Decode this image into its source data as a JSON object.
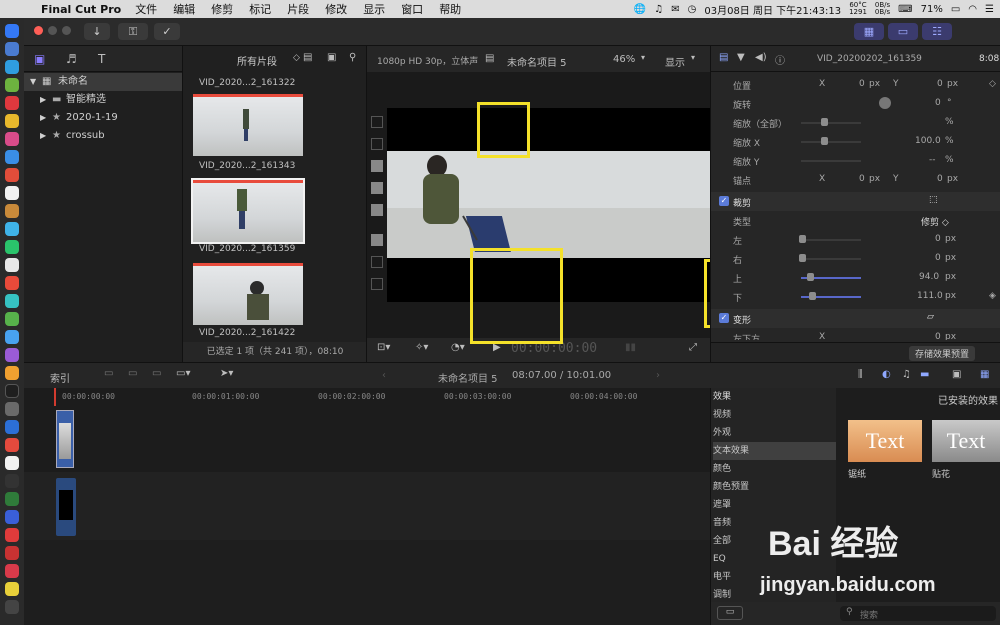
{
  "menubar": {
    "apple": "",
    "app_name": "Final Cut Pro",
    "menus": [
      "文件",
      "编辑",
      "修剪",
      "标记",
      "片段",
      "修改",
      "显示",
      "窗口",
      "帮助"
    ],
    "status": {
      "temp": "60°C",
      "fan": "1291",
      "net_up": "0B/s",
      "net_down": "0B/s",
      "battery": "71%",
      "datetime": "03月08日 周日 下午21:43:13"
    }
  },
  "toolbar": {
    "import_icon": "download-arrow-icon",
    "key_icon": "key-icon",
    "check_icon": "checkmark-circle-icon"
  },
  "library": {
    "filter_label": "所有片段",
    "items": [
      {
        "label": "未命名",
        "icon": "library-grid-icon",
        "selected": true
      },
      {
        "label": "智能精选",
        "icon": "folder-icon"
      },
      {
        "label": "2020-1-19",
        "icon": "event-star-icon"
      },
      {
        "label": "crossub",
        "icon": "event-star-icon"
      }
    ]
  },
  "browser": {
    "clips": [
      {
        "name": "VID_2020...2_161322"
      },
      {
        "name": "VID_2020...2_161343"
      },
      {
        "name": "VID_2020...2_161359"
      },
      {
        "name": "VID_2020...2_161422"
      }
    ],
    "status": "已选定 1 项（共 241 项），08:10"
  },
  "viewer": {
    "format": "1080p HD 30p，立体声",
    "project": "未命名项目 5",
    "zoom": "46%",
    "display_menu": "显示",
    "timecode": "00:00:00:00"
  },
  "inspector": {
    "clip_name": "VID_20200202_161359",
    "duration": "8:08",
    "rows": {
      "position": {
        "label": "位置",
        "x_label": "X",
        "x": "0",
        "x_unit": "px",
        "y_label": "Y",
        "y": "0",
        "y_unit": "px"
      },
      "rotation": {
        "label": "旋转",
        "value": "0",
        "unit": "°"
      },
      "scale_all": {
        "label": "缩放（全部）",
        "unit": "%"
      },
      "scale_x": {
        "label": "缩放 X",
        "value": "100.0",
        "unit": "%"
      },
      "scale_y": {
        "label": "缩放 Y",
        "value": "--",
        "unit": "%"
      },
      "anchor": {
        "label": "锚点",
        "x_label": "X",
        "x": "0",
        "x_unit": "px",
        "y_label": "Y",
        "y": "0",
        "y_unit": "px"
      },
      "crop_section": {
        "label": "裁剪"
      },
      "crop_type": {
        "label": "类型",
        "value": "修剪 ◇"
      },
      "crop_left": {
        "label": "左",
        "value": "0",
        "unit": "px"
      },
      "crop_right": {
        "label": "右",
        "value": "0",
        "unit": "px"
      },
      "crop_top": {
        "label": "上",
        "value": "94.0",
        "unit": "px"
      },
      "crop_bottom": {
        "label": "下",
        "value": "111.0",
        "unit": "px"
      },
      "distort_section": {
        "label": "变形"
      },
      "distort_bl": {
        "label": "左下方",
        "x_label": "X",
        "x": "0",
        "x_unit": "px"
      }
    },
    "save_preset": "存储效果预置"
  },
  "timeline": {
    "index_tab": "索引",
    "project": "未命名项目 5",
    "duration": "08:07.00 / 10:01.00",
    "ruler": [
      "00:00:00:00",
      "00:00:01:00:00",
      "00:00:02:00:00",
      "00:00:03:00:00",
      "00:00:04:00:00"
    ]
  },
  "effects": {
    "header": "效果",
    "categories": [
      {
        "label": "视频"
      },
      {
        "label": "外观"
      },
      {
        "label": "文本效果",
        "selected": true
      },
      {
        "label": "颜色"
      },
      {
        "label": "颜色预置"
      },
      {
        "label": "遮罩"
      },
      {
        "label": "音频"
      },
      {
        "label": "全部"
      },
      {
        "label": "EQ"
      },
      {
        "label": "电平"
      },
      {
        "label": "调制"
      }
    ],
    "installed_title": "已安装的效果",
    "items": [
      {
        "preview_text": "Text",
        "label": "锯纸"
      },
      {
        "preview_text": "Text",
        "label": "贴花"
      }
    ],
    "search_placeholder": "搜索"
  },
  "watermark": {
    "brand": "Bai 经验",
    "url": "jingyan.baidu.com"
  }
}
